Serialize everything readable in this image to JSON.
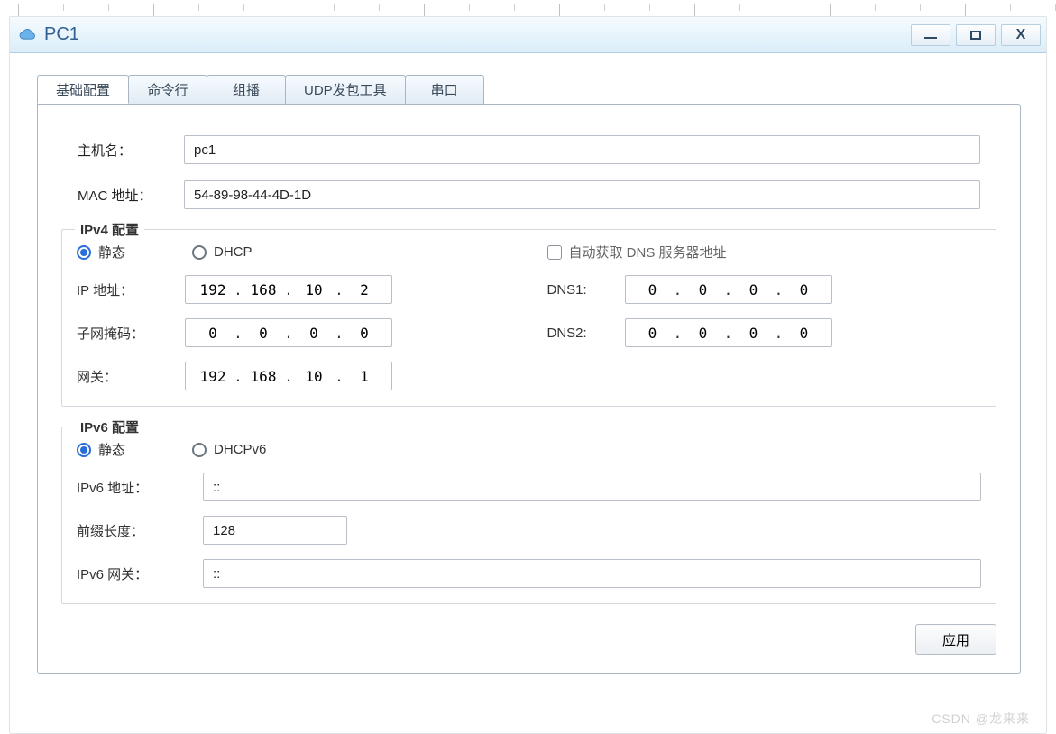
{
  "window": {
    "title": "PC1"
  },
  "tabs": [
    {
      "label": "基础配置",
      "active": true
    },
    {
      "label": "命令行",
      "active": false
    },
    {
      "label": "组播",
      "active": false
    },
    {
      "label": "UDP发包工具",
      "active": false
    },
    {
      "label": "串口",
      "active": false
    }
  ],
  "basic": {
    "hostname_label": "主机名：",
    "hostname_value": "pc1",
    "mac_label": "MAC 地址：",
    "mac_value": "54-89-98-44-4D-1D"
  },
  "ipv4": {
    "legend": "IPv4 配置",
    "radio_static": "静态",
    "radio_dhcp": "DHCP",
    "auto_dns_label": "自动获取 DNS 服务器地址",
    "ip_label": "IP 地址：",
    "ip": [
      "192",
      "168",
      "10",
      "2"
    ],
    "mask_label": "子网掩码：",
    "mask": [
      "0",
      "0",
      "0",
      "0"
    ],
    "gw_label": "网关：",
    "gw": [
      "192",
      "168",
      "10",
      "1"
    ],
    "dns1_label": "DNS1:",
    "dns1": [
      "0",
      "0",
      "0",
      "0"
    ],
    "dns2_label": "DNS2:",
    "dns2": [
      "0",
      "0",
      "0",
      "0"
    ]
  },
  "ipv6": {
    "legend": "IPv6 配置",
    "radio_static": "静态",
    "radio_dhcpv6": "DHCPv6",
    "addr_label": "IPv6 地址：",
    "addr_value": "::",
    "prefix_label": "前缀长度：",
    "prefix_value": "128",
    "gw_label": "IPv6 网关：",
    "gw_value": "::"
  },
  "action": {
    "apply_label": "应用"
  },
  "watermark": "CSDN @龙来来"
}
